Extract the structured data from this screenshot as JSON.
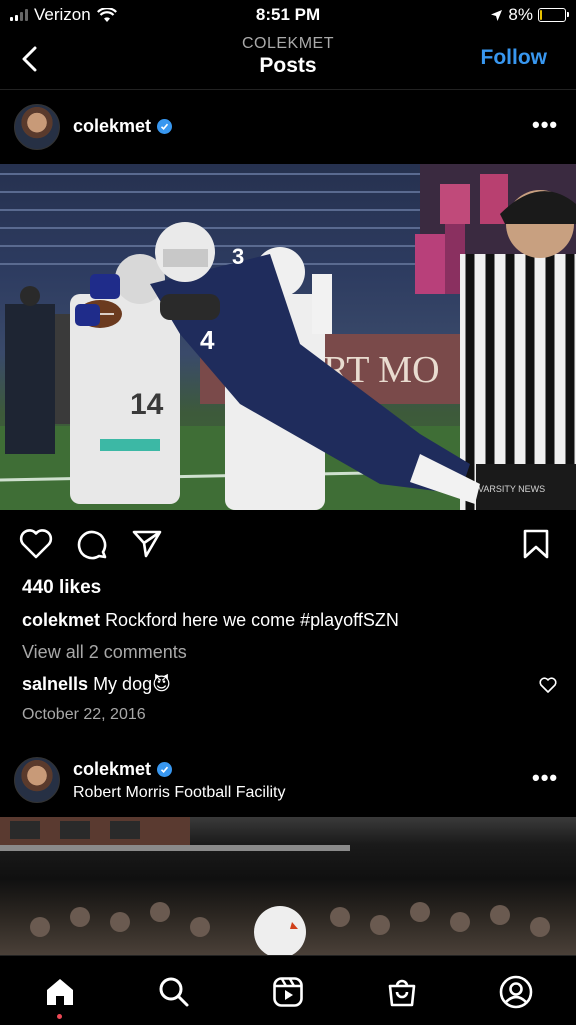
{
  "status_bar": {
    "carrier": "Verizon",
    "time": "8:51 PM",
    "battery": "8%"
  },
  "header": {
    "subtitle": "COLEKMET",
    "title": "Posts",
    "follow_label": "Follow"
  },
  "post1": {
    "username": "colekmet",
    "watermark": "VARSITY NEWS",
    "photo_sign": "ERT MO",
    "jersey_front": "3",
    "jersey_side": "4",
    "jersey_back": "14",
    "likes": "440 likes",
    "caption_user": "colekmet",
    "caption_text": "Rockford here we come #playoffSZN",
    "view_comments": "View all 2 comments",
    "comment_user": "salnells",
    "comment_text": "My dog",
    "comment_emoji": "😈",
    "date": "October 22, 2016"
  },
  "post2": {
    "username": "colekmet",
    "location": "Robert Morris Football Facility"
  },
  "icons": {
    "heart": "heart-icon",
    "comment": "comment-icon",
    "share": "share-icon",
    "bookmark": "bookmark-icon",
    "home": "home-icon",
    "search": "search-icon",
    "reels": "reels-icon",
    "shop": "shop-icon",
    "profile": "profile-icon"
  },
  "colors": {
    "accent": "#3897f0",
    "notification": "#ed4956",
    "background": "#000000",
    "muted": "#a8a8a8"
  }
}
